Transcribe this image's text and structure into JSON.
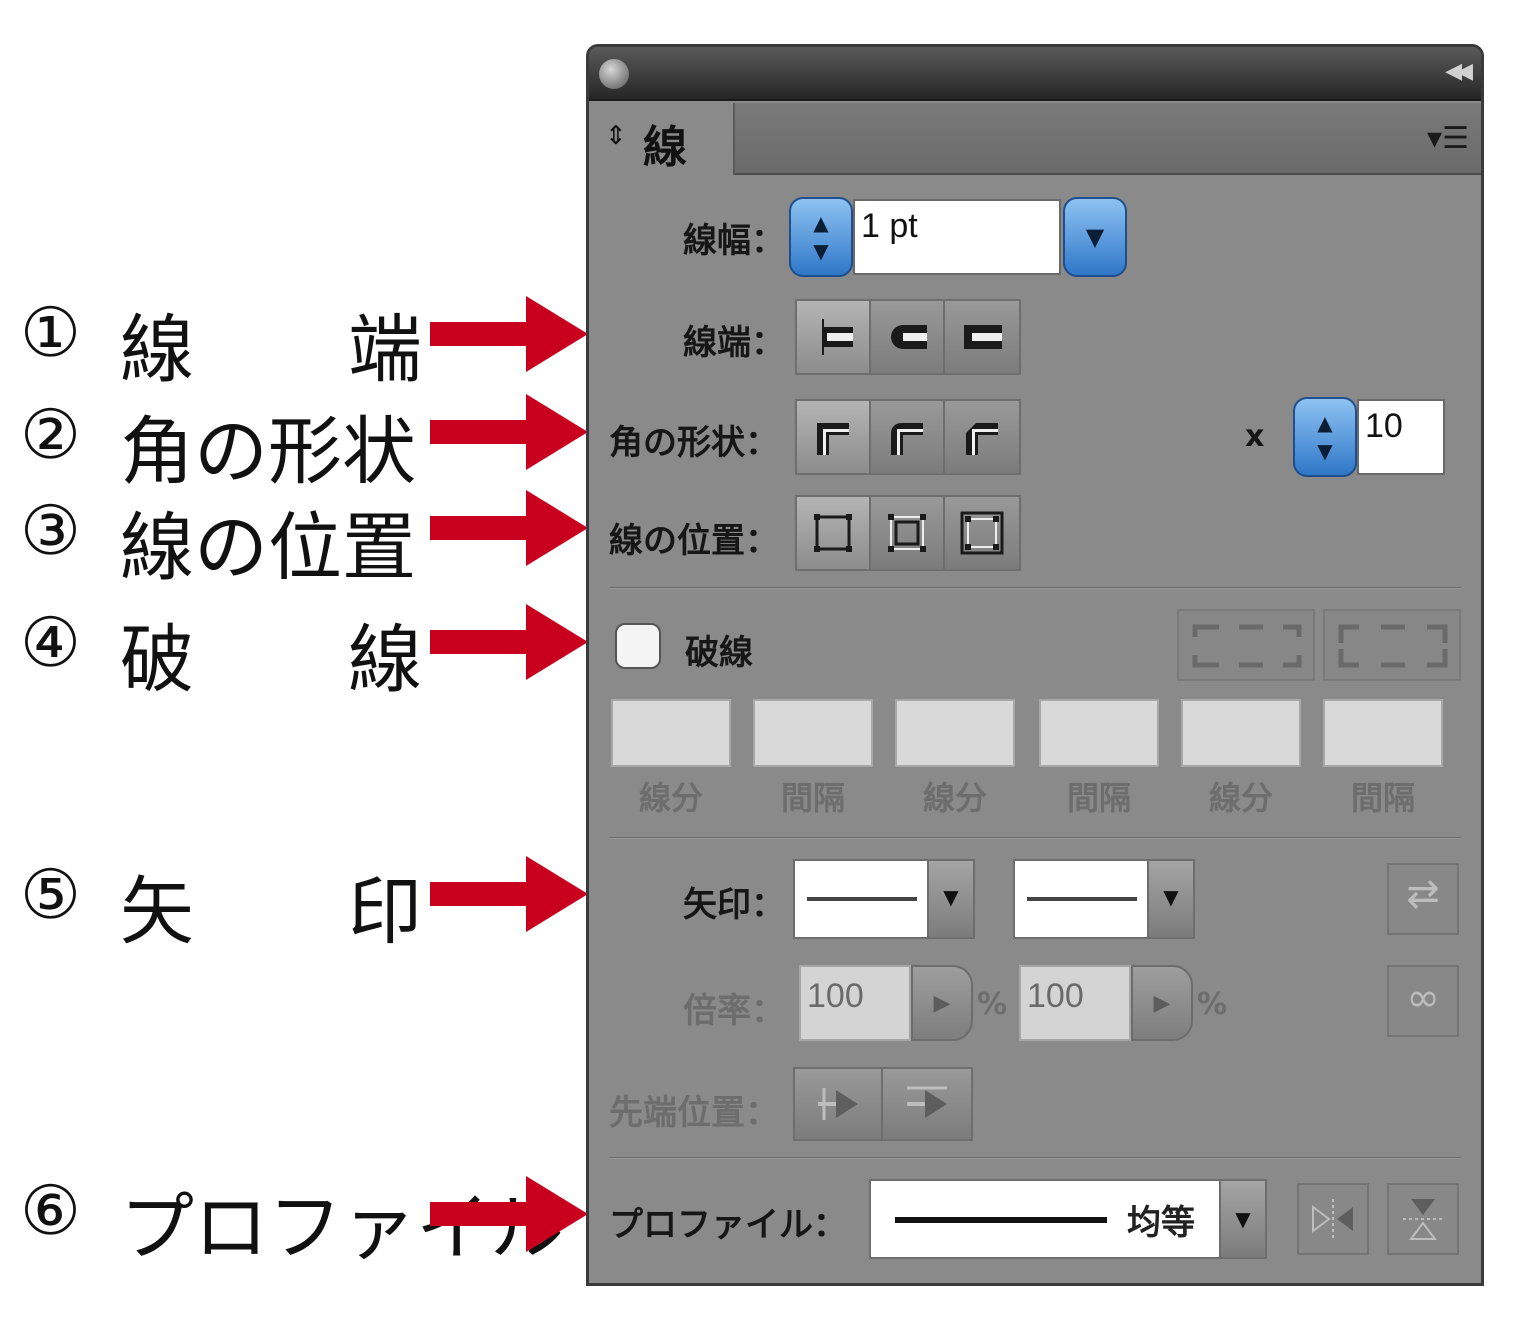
{
  "annotations": [
    {
      "num": "①",
      "a": "線",
      "b": "端"
    },
    {
      "num": "②",
      "a": "角の形状",
      "b": ""
    },
    {
      "num": "③",
      "a": "線の位置",
      "b": ""
    },
    {
      "num": "④",
      "a": "破",
      "b": "線"
    },
    {
      "num": "⑤",
      "a": "矢",
      "b": "印"
    },
    {
      "num": "⑥",
      "a": "プロファイル",
      "b": ""
    }
  ],
  "colors": {
    "arrow": "#c8001e",
    "spinner": "#4a90de"
  },
  "panel": {
    "tab_label": "線",
    "weight": {
      "label": "線幅：",
      "value": "1 pt"
    },
    "cap": {
      "label": "線端："
    },
    "corner": {
      "label": "角の形状：",
      "limit_prefix": "x",
      "limit_value": "10"
    },
    "align": {
      "label": "線の位置："
    },
    "dashed": {
      "label": "破線",
      "checked": false,
      "fields": [
        "線分",
        "間隔",
        "線分",
        "間隔",
        "線分",
        "間隔"
      ]
    },
    "arrowheads": {
      "label": "矢印：",
      "scale_label": "倍率：",
      "scale_start": "100",
      "scale_end": "100",
      "percent": "%",
      "align_label": "先端位置："
    },
    "profile": {
      "label": "プロファイル：",
      "value": "均等"
    }
  }
}
